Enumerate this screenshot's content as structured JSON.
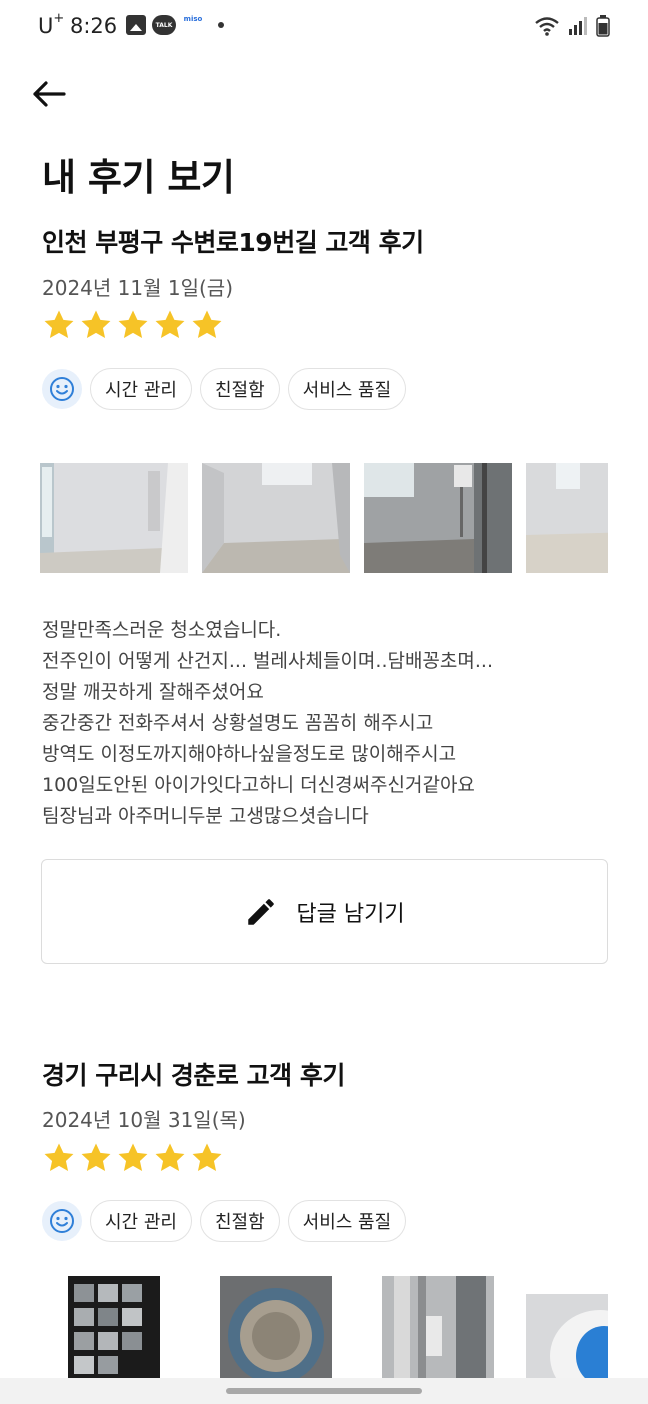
{
  "status_bar": {
    "carrier": "U",
    "carrier_sup": "+",
    "time": "8:26",
    "talk_label": "TALK",
    "miso_label": "miso"
  },
  "page": {
    "title": "내 후기 보기"
  },
  "reviews": [
    {
      "title": "인천 부평구 수변로19번길 고객 후기",
      "date": "2024년 11월 1일(금)",
      "rating": 5,
      "tags": [
        "시간 관리",
        "친절함",
        "서비스 품질"
      ],
      "photo_count_visible": 4,
      "body": [
        "정말만족스러운 청소였습니다.",
        "전주인이 어떻게 산건지... 벌레사체들이며..담배꽁초며...",
        "정말 깨끗하게 잘해주셨어요",
        "중간중간 전화주셔서 상황설명도 꼼꼼히 해주시고",
        "방역도 이정도까지해야하나싶을정도로 많이해주시고",
        "100일도안된 아이가잇다고하니 더신경써주신거같아요",
        "팀장님과 아주머니두분 고생많으셧습니다"
      ],
      "reply_button": "답글 남기기"
    },
    {
      "title": "경기 구리시 경춘로 고객 후기",
      "date": "2024년 10월 31일(목)",
      "rating": 5,
      "tags": [
        "시간 관리",
        "친절함",
        "서비스 품질"
      ],
      "photo_count_visible": 4
    }
  ],
  "colors": {
    "star": "#f6c327",
    "accent_blue": "#2f7fd8",
    "smile_bg": "#e7f0fb",
    "border": "#dcdcdc"
  }
}
